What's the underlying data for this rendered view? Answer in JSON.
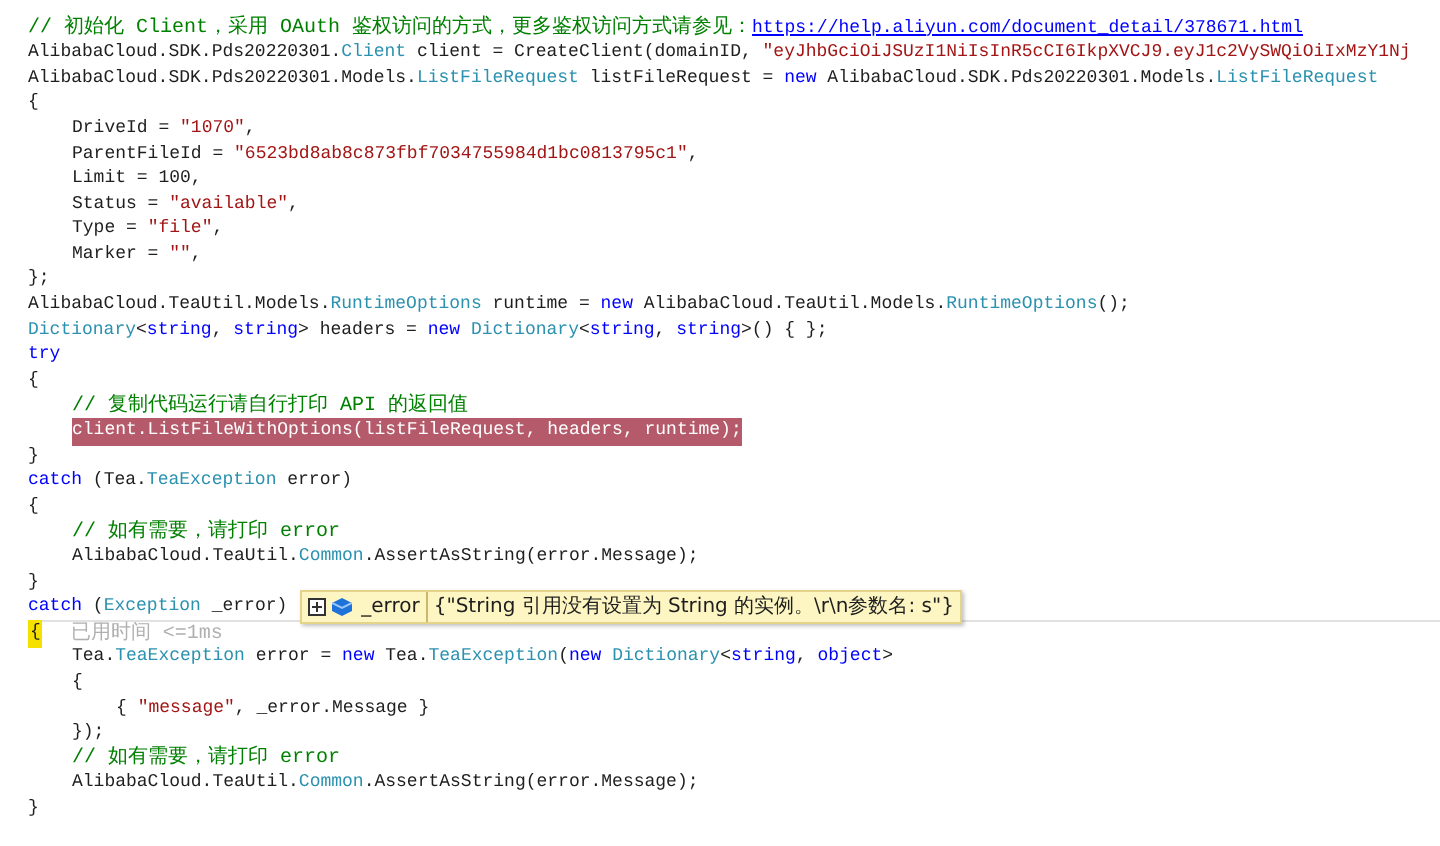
{
  "lines": [
    {
      "tokens": [
        {
          "kind": "comment",
          "text": "// 初始化 Client，采用 OAuth 鉴权访问的方式，更多鉴权访问方式请参见："
        },
        {
          "kind": "link",
          "text": "https://help.aliyun.com/document_detail/378671.html"
        }
      ]
    },
    {
      "tokens": [
        {
          "kind": "text",
          "text": "AlibabaCloud.SDK.Pds20220301."
        },
        {
          "kind": "type",
          "text": "Client"
        },
        {
          "kind": "text",
          "text": " client = CreateClient(domainID, "
        },
        {
          "kind": "string",
          "text": "\"eyJhbGciOiJSUzI1NiIsInR5cCI6IkpXVCJ9.eyJ1c2VySWQiOiIxMzY1Nj"
        }
      ]
    },
    {
      "tokens": [
        {
          "kind": "text",
          "text": "AlibabaCloud.SDK.Pds20220301.Models."
        },
        {
          "kind": "type",
          "text": "ListFileRequest"
        },
        {
          "kind": "text",
          "text": " listFileRequest = "
        },
        {
          "kind": "keyword",
          "text": "new"
        },
        {
          "kind": "text",
          "text": " AlibabaCloud.SDK.Pds20220301.Models."
        },
        {
          "kind": "type",
          "text": "ListFileRequest"
        }
      ]
    },
    {
      "tokens": [
        {
          "kind": "text",
          "text": "{"
        }
      ],
      "children": [
        {
          "tokens": [
            {
              "kind": "text",
              "text": "DriveId = "
            },
            {
              "kind": "string",
              "text": "\"1070\""
            },
            {
              "kind": "text",
              "text": ","
            }
          ]
        },
        {
          "tokens": [
            {
              "kind": "text",
              "text": "ParentFileId = "
            },
            {
              "kind": "string",
              "text": "\"6523bd8ab8c873fbf7034755984d1bc0813795c1\""
            },
            {
              "kind": "text",
              "text": ","
            }
          ]
        },
        {
          "tokens": [
            {
              "kind": "text",
              "text": "Limit = 100,"
            }
          ]
        },
        {
          "tokens": [
            {
              "kind": "text",
              "text": "Status = "
            },
            {
              "kind": "string",
              "text": "\"available\""
            },
            {
              "kind": "text",
              "text": ","
            }
          ]
        },
        {
          "tokens": [
            {
              "kind": "text",
              "text": "Type = "
            },
            {
              "kind": "string",
              "text": "\"file\""
            },
            {
              "kind": "text",
              "text": ","
            }
          ]
        },
        {
          "tokens": [
            {
              "kind": "text",
              "text": "Marker = "
            },
            {
              "kind": "string",
              "text": "\"\""
            },
            {
              "kind": "text",
              "text": ","
            }
          ]
        }
      ]
    },
    {
      "tokens": [
        {
          "kind": "text",
          "text": "};"
        }
      ]
    },
    {
      "tokens": [
        {
          "kind": "text",
          "text": "AlibabaCloud.TeaUtil.Models."
        },
        {
          "kind": "type",
          "text": "RuntimeOptions"
        },
        {
          "kind": "text",
          "text": " runtime = "
        },
        {
          "kind": "keyword",
          "text": "new"
        },
        {
          "kind": "text",
          "text": " AlibabaCloud.TeaUtil.Models."
        },
        {
          "kind": "type",
          "text": "RuntimeOptions"
        },
        {
          "kind": "text",
          "text": "();"
        }
      ]
    },
    {
      "tokens": [
        {
          "kind": "type",
          "text": "Dictionary"
        },
        {
          "kind": "text",
          "text": "<"
        },
        {
          "kind": "keyword",
          "text": "string"
        },
        {
          "kind": "text",
          "text": ", "
        },
        {
          "kind": "keyword",
          "text": "string"
        },
        {
          "kind": "text",
          "text": "> headers = "
        },
        {
          "kind": "keyword",
          "text": "new "
        },
        {
          "kind": "type",
          "text": "Dictionary"
        },
        {
          "kind": "text",
          "text": "<"
        },
        {
          "kind": "keyword",
          "text": "string"
        },
        {
          "kind": "text",
          "text": ", "
        },
        {
          "kind": "keyword",
          "text": "string"
        },
        {
          "kind": "text",
          "text": ">() { };"
        }
      ]
    },
    {
      "tokens": [
        {
          "kind": "keyword",
          "text": "try"
        }
      ]
    },
    {
      "tokens": [
        {
          "kind": "text",
          "text": "{"
        }
      ],
      "children": [
        {
          "tokens": [
            {
              "kind": "comment",
              "text": "// 复制代码运行请自行打印 API 的返回值"
            }
          ]
        },
        {
          "highlighted": true,
          "tokens": [
            {
              "kind": "text",
              "text": "client.ListFileWithOptions(listFileRequest, headers, runtime);"
            }
          ]
        }
      ]
    },
    {
      "tokens": [
        {
          "kind": "text",
          "text": "}"
        }
      ]
    },
    {
      "tokens": [
        {
          "kind": "keyword",
          "text": "catch"
        },
        {
          "kind": "text",
          "text": " (Tea."
        },
        {
          "kind": "type",
          "text": "TeaException"
        },
        {
          "kind": "text",
          "text": " error)"
        }
      ]
    },
    {
      "tokens": [
        {
          "kind": "text",
          "text": "{"
        }
      ],
      "children": [
        {
          "tokens": [
            {
              "kind": "comment",
              "text": "// 如有需要，请打印 error"
            }
          ]
        },
        {
          "tokens": [
            {
              "kind": "text",
              "text": "AlibabaCloud.TeaUtil."
            },
            {
              "kind": "type",
              "text": "Common"
            },
            {
              "kind": "text",
              "text": ".AssertAsString(error.Message);"
            }
          ]
        }
      ]
    },
    {
      "tokens": [
        {
          "kind": "text",
          "text": "}"
        }
      ]
    },
    {
      "tokens": [
        {
          "kind": "keyword",
          "text": "catch"
        },
        {
          "kind": "text",
          "text": " ("
        },
        {
          "kind": "type",
          "text": "Exception"
        },
        {
          "kind": "text",
          "text": " _error)"
        }
      ],
      "datatip": {
        "name": "_error",
        "value": "{\"String 引用没有设置为 String 的实例。\\r\\n参数名: s\"}"
      }
    },
    {
      "current": true,
      "perf_tip": "已用时间 <=1ms",
      "tokens": [
        {
          "kind": "text",
          "text": "{"
        }
      ],
      "children": [
        {
          "tokens": [
            {
              "kind": "text",
              "text": "Tea."
            },
            {
              "kind": "type",
              "text": "TeaException"
            },
            {
              "kind": "text",
              "text": " error = "
            },
            {
              "kind": "keyword",
              "text": "new"
            },
            {
              "kind": "text",
              "text": " Tea."
            },
            {
              "kind": "type",
              "text": "TeaException"
            },
            {
              "kind": "text",
              "text": "("
            },
            {
              "kind": "keyword",
              "text": "new "
            },
            {
              "kind": "type",
              "text": "Dictionary"
            },
            {
              "kind": "text",
              "text": "<"
            },
            {
              "kind": "keyword",
              "text": "string"
            },
            {
              "kind": "text",
              "text": ", "
            },
            {
              "kind": "keyword",
              "text": "object"
            },
            {
              "kind": "text",
              "text": ">"
            }
          ]
        },
        {
          "tokens": [
            {
              "kind": "text",
              "text": "{"
            }
          ],
          "children": [
            {
              "tokens": [
                {
                  "kind": "text",
                  "text": "{ "
                },
                {
                  "kind": "string",
                  "text": "\"message\""
                },
                {
                  "kind": "text",
                  "text": ", _error.Message }"
                }
              ]
            }
          ]
        },
        {
          "tokens": [
            {
              "kind": "text",
              "text": "});"
            }
          ]
        },
        {
          "tokens": [
            {
              "kind": "comment",
              "text": "// 如有需要，请打印 error"
            }
          ]
        },
        {
          "tokens": [
            {
              "kind": "text",
              "text": "AlibabaCloud.TeaUtil."
            },
            {
              "kind": "type",
              "text": "Common"
            },
            {
              "kind": "text",
              "text": ".AssertAsString(error.Message);"
            }
          ]
        }
      ]
    },
    {
      "tokens": [
        {
          "kind": "text",
          "text": "}"
        }
      ]
    }
  ]
}
